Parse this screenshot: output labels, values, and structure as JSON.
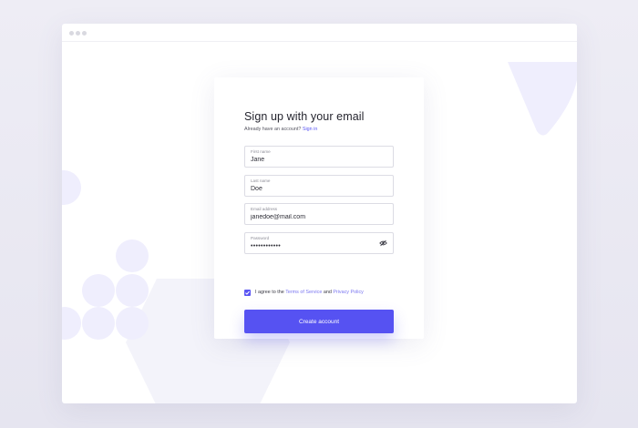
{
  "signup": {
    "title": "Sign up with your email",
    "subtitle_prefix": "Already have an account?",
    "signin_link": "Sign in",
    "fields": [
      {
        "label": "First name",
        "value": "Jane"
      },
      {
        "label": "Last name",
        "value": "Doe"
      },
      {
        "label": "Email address",
        "value": "janedoe@mail.com"
      },
      {
        "label": "Password",
        "value": "••••••••••••"
      }
    ],
    "agree_prefix": "I agree to the",
    "terms_link": "Terms of Service",
    "agree_and": "and",
    "privacy_link": "Privacy Policy",
    "checkbox_checked": true,
    "submit_label": "Create account"
  },
  "colors": {
    "accent": "#5652f2",
    "decoration": "#efeefd",
    "background": "#ebeaf3"
  },
  "icons": {
    "password_toggle": "eye-slash-icon",
    "checkbox": "checkmark-icon"
  }
}
